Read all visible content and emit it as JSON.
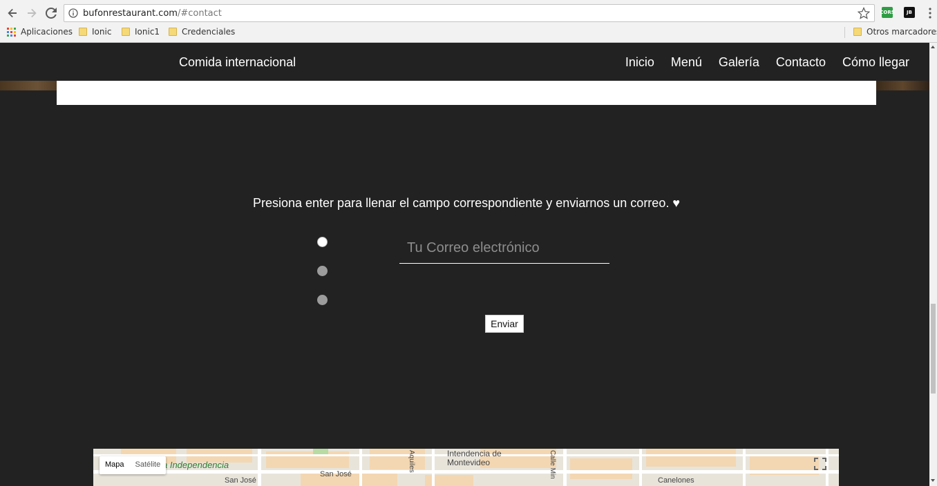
{
  "browser": {
    "url_host": "bufonrestaurant.com",
    "url_path": "/#contact",
    "extensions": [
      {
        "label": "CORS",
        "color": "#2e9e44"
      },
      {
        "label": "JB",
        "color": "#111111"
      }
    ],
    "bookmarks": [
      {
        "label": "Aplicaciones",
        "icon": "apps-grid-icon"
      },
      {
        "label": "Ionic",
        "icon": "folder-icon"
      },
      {
        "label": "Ionic1",
        "icon": "folder-icon"
      },
      {
        "label": "Credenciales",
        "icon": "folder-icon"
      }
    ],
    "other_bookmarks": "Otros marcadores"
  },
  "site": {
    "brand": "Comida internacional",
    "nav": [
      "Inicio",
      "Menú",
      "Galería",
      "Contacto",
      "Cómo llegar"
    ]
  },
  "contact": {
    "instruction": "Presiona enter para llenar el campo correspondiente y enviarnos un correo. ♥",
    "email_placeholder": "Tu Correo electrónico",
    "submit_label": "Enviar",
    "steps_total": 3,
    "step_active": 1
  },
  "map": {
    "type_options": [
      "Mapa",
      "Satélite"
    ],
    "selected_type": "Mapa",
    "labels": {
      "independencia": "a Independencia",
      "intendencia_1": "Intendencia de",
      "intendencia_2": "Montevideo",
      "san_jose_1": "San José",
      "san_jose_2": "San José",
      "aquiles": "Aquiles",
      "calle": "Calle Min",
      "canelones": "Canelones"
    }
  },
  "colors": {
    "page_bg": "#222222",
    "accent_white": "#ffffff",
    "placeholder": "#8d8d8d"
  }
}
